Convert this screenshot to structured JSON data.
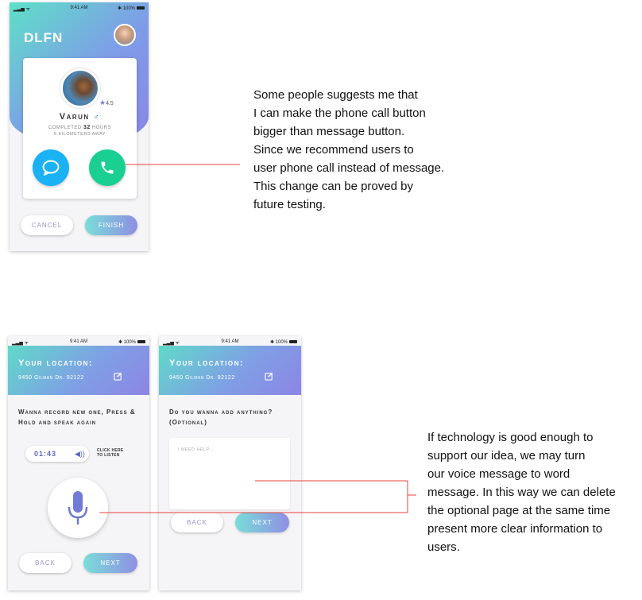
{
  "colors": {
    "annotation_line": "#e8413c",
    "accent_call": "#19cf92",
    "accent_message": "#1ab2f5",
    "gradient_start": "#5ee0c8",
    "gradient_end": "#8a86e6"
  },
  "status_bar": {
    "time": "9:41 AM",
    "battery": "100%"
  },
  "screen_profile": {
    "logo": "DLFN",
    "rating": "4.5",
    "name": "Varun",
    "completed_prefix": "completed",
    "hours_value": "32",
    "hours_unit": "hours",
    "distance": "5 kilometers away",
    "cancel": "CANCEL",
    "finish": "FINISH"
  },
  "screen_record": {
    "location_title": "Your location:",
    "address": "9450 Gilman Dr. 92122",
    "prompt": "Wanna record new one, Press & Hold and speak again",
    "duration": "01:43",
    "listen": [
      "CLICK HERE",
      "TO LISTEN"
    ],
    "back": "BACK",
    "next": "NEXT"
  },
  "screen_optional": {
    "location_title": "Your location:",
    "address": "9450 Gilman Dr. 92122",
    "prompt": "Do you wanna add anything? (Optional)",
    "placeholder": "I NEED HELP...",
    "back": "BACK",
    "next": "NEXT"
  },
  "notes": {
    "note1": [
      "Some people suggests me that",
      "I can make the phone call button",
      "bigger than message button.",
      "Since we recommend users to",
      "user phone call instead of message.",
      "This change can be proved by",
      "future testing."
    ],
    "note2": [
      "If technology is good enough to",
      "support our idea, we may turn",
      "our voice message to word",
      "message. In this way we can delete",
      "the optional page at the same time",
      "present more clear information to",
      "users."
    ]
  }
}
